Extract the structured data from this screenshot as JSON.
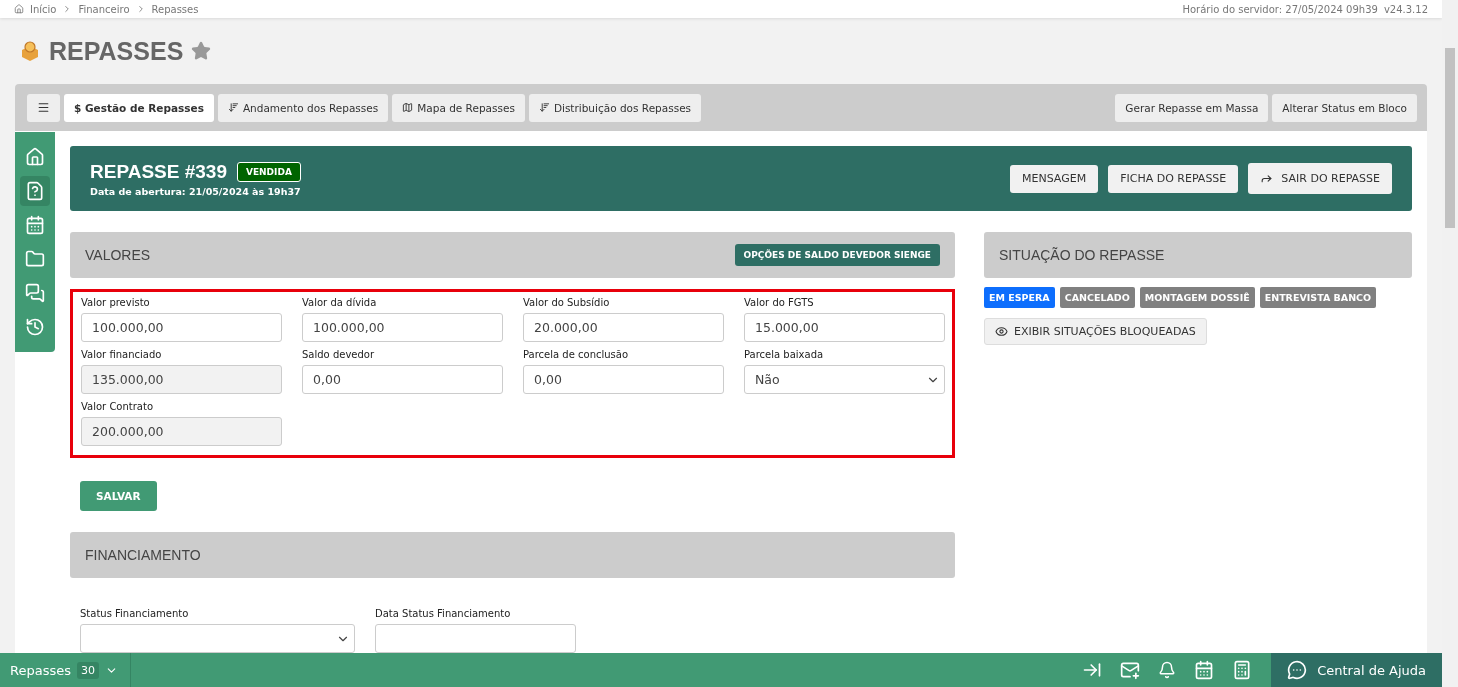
{
  "breadcrumb": [
    "Início",
    "Financeiro",
    "Repasses"
  ],
  "server_time": "Horário do servidor: 27/05/2024 09h39",
  "version": "v24.3.12",
  "page_title": "REPASSES",
  "favorite": false,
  "tabs": [
    {
      "label": "$ Gestão de Repasses",
      "selected": true,
      "kind": "plain"
    },
    {
      "label": "Andamento dos Repasses",
      "selected": false,
      "kind": "sort"
    },
    {
      "label": "Mapa de Repasses",
      "selected": false,
      "kind": "map"
    },
    {
      "label": "Distribuição dos Repasses",
      "selected": false,
      "kind": "sort"
    }
  ],
  "toolbar_actions": [
    "Gerar Repasse em Massa",
    "Alterar Status em Bloco"
  ],
  "side_nav": [
    {
      "kind": "home",
      "selected": false
    },
    {
      "kind": "file",
      "selected": true
    },
    {
      "kind": "calendar",
      "selected": false
    },
    {
      "kind": "folder",
      "selected": false
    },
    {
      "kind": "chat",
      "selected": false
    },
    {
      "kind": "history",
      "selected": false
    }
  ],
  "header": {
    "title": "REPASSE #339",
    "badge": "VENDIDA",
    "subtitle": "Data de abertura: 21/05/2024 às 19h37",
    "buttons": [
      {
        "label": "MENSAGEM",
        "kind": "plain"
      },
      {
        "label": "FICHA DO REPASSE",
        "kind": "plain"
      },
      {
        "label": "SAIR DO REPASSE",
        "kind": "exit"
      }
    ]
  },
  "valores": {
    "title": "VALORES",
    "action": "OPÇÕES DE SALDO DEVEDOR SIENGE",
    "highlighted": true,
    "fields": [
      {
        "label": "Valor previsto",
        "value": "100.000,00",
        "kind": "input"
      },
      {
        "label": "Valor da dívida",
        "value": "100.000,00",
        "kind": "input"
      },
      {
        "label": "Valor do Subsídio",
        "value": "20.000,00",
        "kind": "input"
      },
      {
        "label": "Valor do FGTS",
        "value": "15.000,00",
        "kind": "input"
      },
      {
        "label": "Valor financiado",
        "value": "135.000,00",
        "kind": "input",
        "disabled": true
      },
      {
        "label": "Saldo devedor",
        "value": "0,00",
        "kind": "input"
      },
      {
        "label": "Parcela de conclusão",
        "value": "0,00",
        "kind": "input"
      },
      {
        "label": "Parcela baixada",
        "value": "Não",
        "kind": "select"
      },
      {
        "label": "Valor Contrato",
        "value": "200.000,00",
        "kind": "input",
        "disabled": true
      }
    ],
    "save": "SALVAR"
  },
  "situacao": {
    "title": "SITUAÇÃO DO REPASSE",
    "statuses": [
      {
        "label": "EM ESPERA",
        "color": "#0d6efd"
      },
      {
        "label": "CANCELADO",
        "color": "#808080"
      },
      {
        "label": "MONTAGEM DOSSIÊ",
        "color": "#808080"
      },
      {
        "label": "ENTREVISTA BANCO",
        "color": "#808080"
      }
    ],
    "show_blocked": "EXIBIR SITUAÇÕES BLOQUEADAS"
  },
  "financiamento": {
    "title": "FINANCIAMENTO",
    "fields": [
      {
        "label": "Status Financiamento",
        "kind": "select"
      },
      {
        "label": "Data Status Financiamento",
        "kind": "input"
      }
    ]
  },
  "bottom_bar": {
    "label": "Repasses",
    "count": "30",
    "help": "Central de Ajuda"
  }
}
